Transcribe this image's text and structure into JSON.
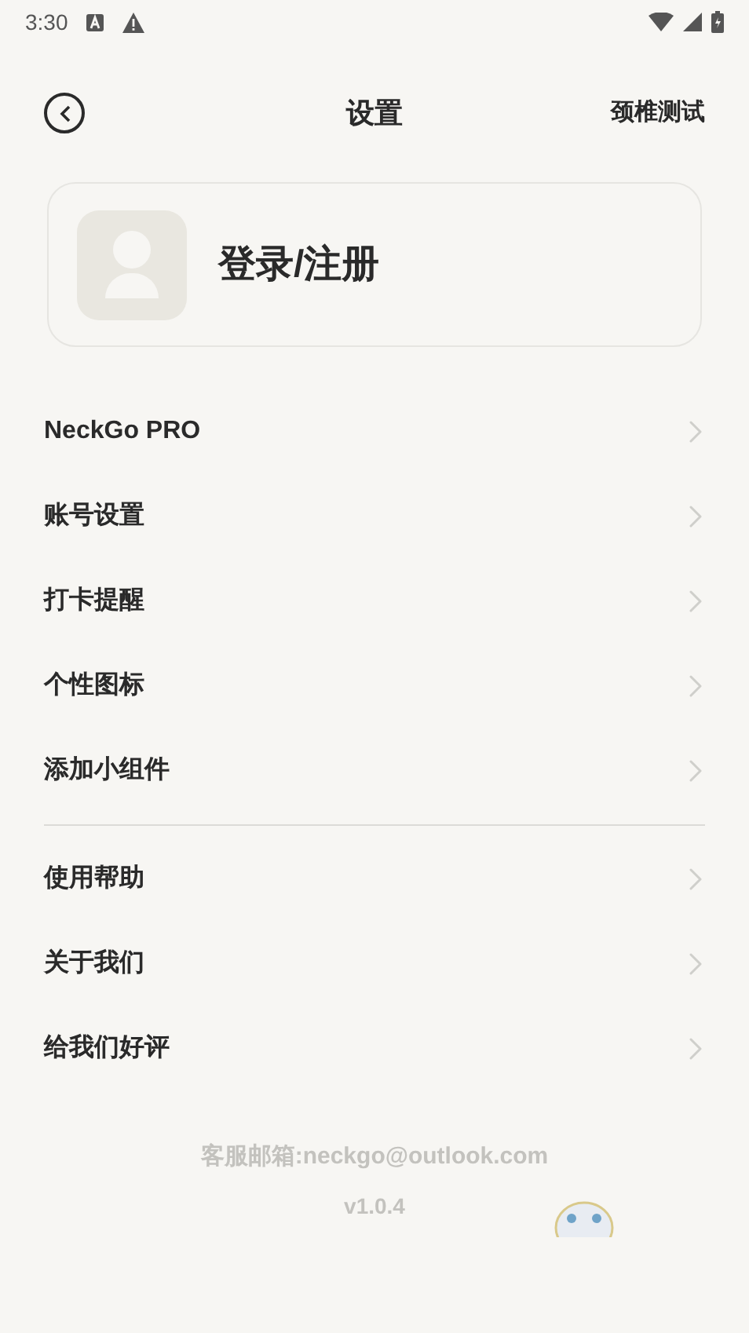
{
  "status_bar": {
    "time": "3:30"
  },
  "header": {
    "title": "设置",
    "action": "颈椎测试"
  },
  "profile": {
    "label": "登录/注册"
  },
  "menu_groups": [
    {
      "items": [
        {
          "label": "NeckGo PRO"
        },
        {
          "label": "账号设置"
        },
        {
          "label": "打卡提醒"
        },
        {
          "label": "个性图标"
        },
        {
          "label": "添加小组件"
        }
      ]
    },
    {
      "items": [
        {
          "label": "使用帮助"
        },
        {
          "label": "关于我们"
        },
        {
          "label": "给我们好评"
        }
      ]
    }
  ],
  "footer": {
    "email": "客服邮箱:neckgo@outlook.com",
    "version": "v1.0.4"
  }
}
